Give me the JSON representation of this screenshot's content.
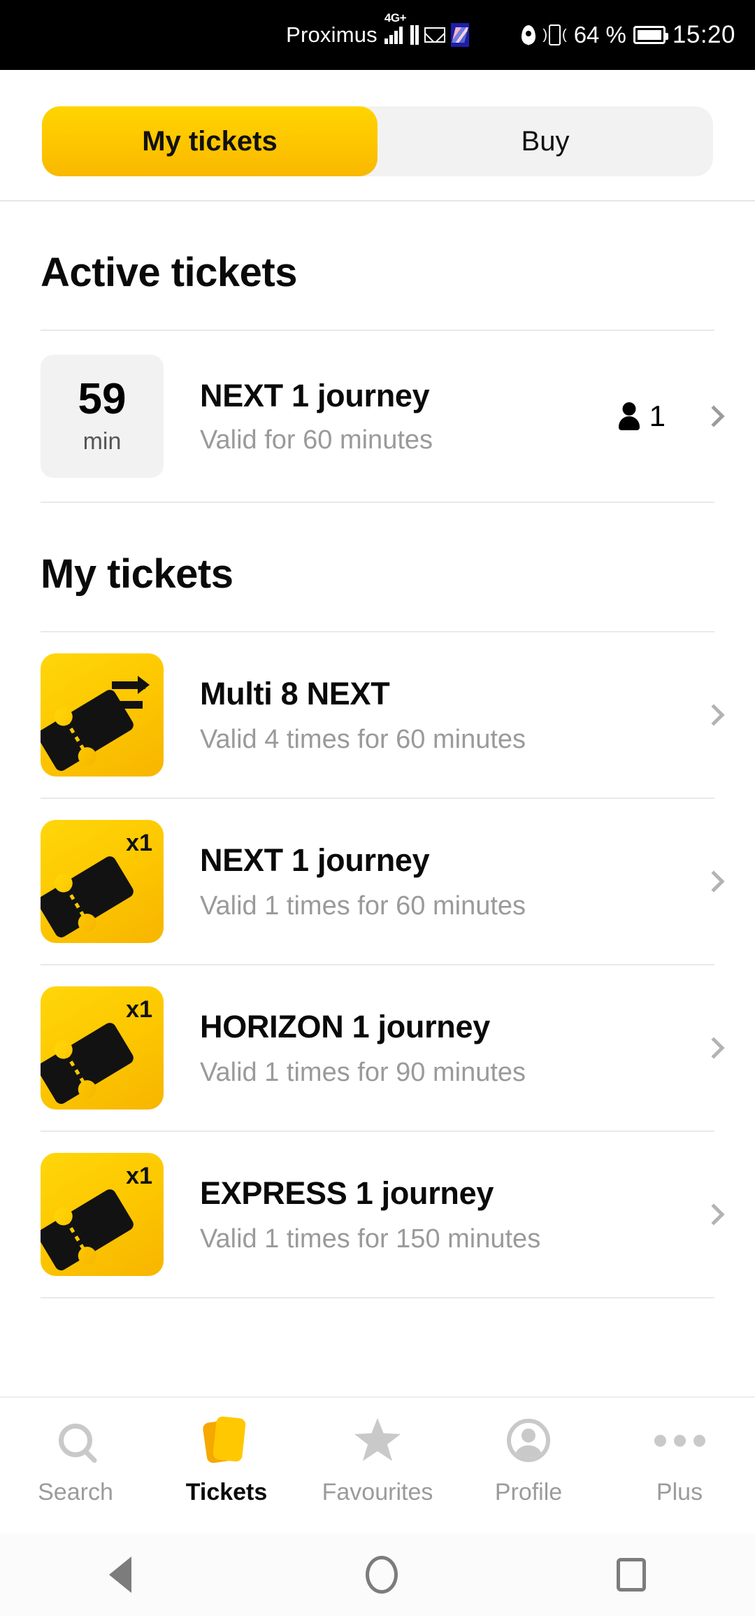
{
  "statusbar": {
    "carrier": "Proximus",
    "network": "4G+",
    "battery_percent": "64 %",
    "clock": "15:20",
    "icons": [
      "signal-icon",
      "mail-icon",
      "app-icon",
      "location-pin-icon",
      "vibrate-icon",
      "battery-icon"
    ]
  },
  "tabs": {
    "selected": "My tickets",
    "items": [
      {
        "label": "My tickets",
        "selected": true
      },
      {
        "label": "Buy",
        "selected": false
      }
    ]
  },
  "active_section": {
    "title": "Active tickets",
    "ticket": {
      "time_value": "59",
      "time_unit": "min",
      "name": "NEXT 1 journey",
      "validity": "Valid for 60 minutes",
      "passenger_count": "1"
    }
  },
  "my_tickets_section": {
    "title": "My tickets",
    "items": [
      {
        "name": "Multi 8 NEXT",
        "validity": "Valid 4 times for 60 minutes",
        "badge": "",
        "icon": "multi-ticket-arrows-icon"
      },
      {
        "name": "NEXT 1 journey",
        "validity": "Valid 1 times for 60 minutes",
        "badge": "x1",
        "icon": "single-ticket-icon"
      },
      {
        "name": "HORIZON 1 journey",
        "validity": "Valid 1 times for 90 minutes",
        "badge": "x1",
        "icon": "single-ticket-icon"
      },
      {
        "name": "EXPRESS 1 journey",
        "validity": "Valid 1 times for 150 minutes",
        "badge": "x1",
        "icon": "single-ticket-icon"
      }
    ]
  },
  "bottom_nav": {
    "items": [
      {
        "label": "Search",
        "icon": "search-icon",
        "active": false
      },
      {
        "label": "Tickets",
        "icon": "tickets-icon",
        "active": true
      },
      {
        "label": "Favourites",
        "icon": "star-icon",
        "active": false
      },
      {
        "label": "Profile",
        "icon": "profile-icon",
        "active": false
      },
      {
        "label": "Plus",
        "icon": "more-dots-icon",
        "active": false
      }
    ]
  },
  "system_nav": {
    "back": "back-icon",
    "home": "home-icon",
    "recents": "recents-icon"
  },
  "colors": {
    "accent_yellow": "#FFC800",
    "accent_yellow_dark": "#F7B500",
    "text_primary": "#0A0A0A",
    "text_secondary": "#9A9A9A",
    "divider": "#E9E9E9",
    "surface_gray": "#F2F2F2"
  }
}
